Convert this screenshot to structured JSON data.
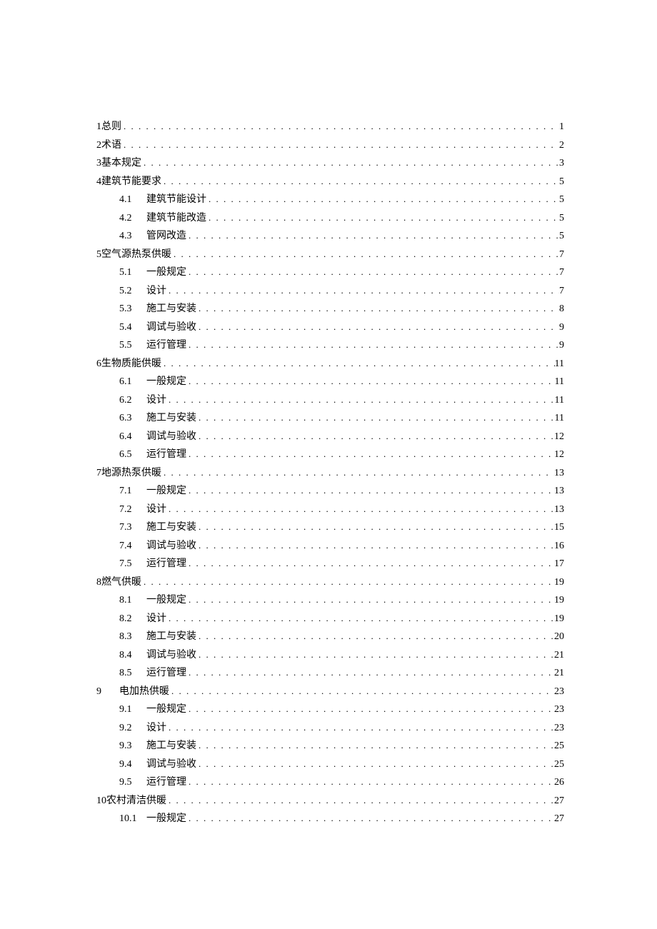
{
  "toc": [
    {
      "type": "top",
      "num": "1",
      "title": "总则",
      "page": "1"
    },
    {
      "type": "top",
      "num": "2",
      "title": "术语",
      "page": "2"
    },
    {
      "type": "top",
      "num": "3",
      "title": "基本规定",
      "page": "3"
    },
    {
      "type": "top",
      "num": "4",
      "title": "建筑节能要求",
      "page": "5"
    },
    {
      "type": "sub",
      "num": "4.1",
      "title": "建筑节能设计",
      "page": "5"
    },
    {
      "type": "sub",
      "num": "4.2",
      "title": "建筑节能改造",
      "page": "5"
    },
    {
      "type": "sub",
      "num": "4.3",
      "title": "管网改造",
      "page": "5"
    },
    {
      "type": "top",
      "num": "5",
      "title": "空气源热泵供暖",
      "page": "7"
    },
    {
      "type": "sub",
      "num": "5.1",
      "title": "一般规定",
      "page": "7"
    },
    {
      "type": "sub",
      "num": "5.2",
      "title": "设计",
      "page": "7"
    },
    {
      "type": "sub",
      "num": "5.3",
      "title": "施工与安装",
      "page": "8"
    },
    {
      "type": "sub",
      "num": "5.4",
      "title": "调试与验收",
      "page": "9"
    },
    {
      "type": "sub",
      "num": "5.5",
      "title": "运行管理",
      "page": "9"
    },
    {
      "type": "top",
      "num": "6",
      "title": "生物质能供暖",
      "page": "11"
    },
    {
      "type": "sub",
      "num": "6.1",
      "title": "一般规定",
      "page": "11"
    },
    {
      "type": "sub",
      "num": "6.2",
      "title": "设计",
      "page": "11"
    },
    {
      "type": "sub",
      "num": "6.3",
      "title": "施工与安装",
      "page": "11"
    },
    {
      "type": "sub",
      "num": "6.4",
      "title": "调试与验收",
      "page": "12"
    },
    {
      "type": "sub",
      "num": "6.5",
      "title": "运行管理",
      "page": "12"
    },
    {
      "type": "top",
      "num": "7",
      "title": "地源热泵供暖",
      "page": "13"
    },
    {
      "type": "sub",
      "num": "7.1",
      "title": "一般规定",
      "page": "13"
    },
    {
      "type": "sub",
      "num": "7.2",
      "title": "设计",
      "page": "13"
    },
    {
      "type": "sub",
      "num": "7.3",
      "title": "施工与安装",
      "page": "15"
    },
    {
      "type": "sub",
      "num": "7.4",
      "title": "调试与验收",
      "page": "16"
    },
    {
      "type": "sub",
      "num": "7.5",
      "title": "运行管理",
      "page": "17"
    },
    {
      "type": "top",
      "num": "8",
      "title": "燃气供暖",
      "page": "19"
    },
    {
      "type": "sub",
      "num": "8.1",
      "title": "一般规定",
      "page": "19"
    },
    {
      "type": "sub",
      "num": "8.2",
      "title": "设计",
      "page": "19"
    },
    {
      "type": "sub",
      "num": "8.3",
      "title": "施工与安装",
      "page": "20"
    },
    {
      "type": "sub",
      "num": "8.4",
      "title": "调试与验收",
      "page": "21"
    },
    {
      "type": "sub",
      "num": "8.5",
      "title": "运行管理",
      "page": "21"
    },
    {
      "type": "special",
      "num": "9",
      "title": "电加热供暖",
      "page": "23"
    },
    {
      "type": "sub",
      "num": "9.1",
      "title": "一般规定",
      "page": "23"
    },
    {
      "type": "sub",
      "num": "9.2",
      "title": "设计",
      "page": "23"
    },
    {
      "type": "sub",
      "num": "9.3",
      "title": "施工与安装",
      "page": "25"
    },
    {
      "type": "sub",
      "num": "9.4",
      "title": "调试与验收",
      "page": "25"
    },
    {
      "type": "sub",
      "num": "9.5",
      "title": "运行管理",
      "page": "26"
    },
    {
      "type": "top",
      "num": "10",
      "title": "农村清洁供暖",
      "page": "27"
    },
    {
      "type": "sub",
      "num": "10.1",
      "title": "一般规定",
      "page": "27"
    }
  ]
}
